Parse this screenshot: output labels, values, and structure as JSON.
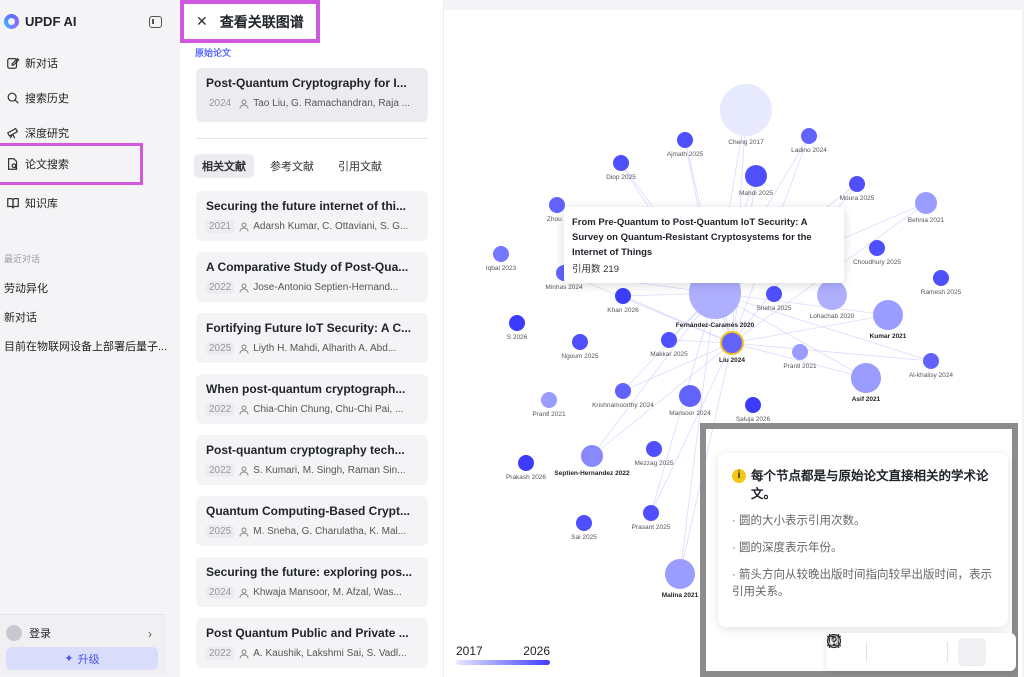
{
  "app": {
    "name": "UPDF AI"
  },
  "sidebar": {
    "nav": [
      {
        "label": "新对话",
        "icon": "edit-icon"
      },
      {
        "label": "搜索历史",
        "icon": "search-icon"
      },
      {
        "label": "深度研究",
        "icon": "telescope-icon"
      },
      {
        "label": "论文搜索",
        "icon": "paper-search-icon"
      },
      {
        "label": "知识库",
        "icon": "book-icon"
      }
    ],
    "recent_label": "最近对话",
    "recent": [
      "劳动异化",
      "新对话",
      "目前在物联网设备上部署后量子..."
    ],
    "login_label": "登录",
    "upgrade_label": "升级"
  },
  "panel": {
    "title": "查看关联图谱",
    "original_label": "原始论文",
    "original": {
      "title": "Post-Quantum Cryptography for I...",
      "year": "2024",
      "authors": "Tao Liu, G. Ramachandran, Raja ..."
    },
    "tabs": [
      "相关文献",
      "参考文献",
      "引用文献"
    ],
    "papers": [
      {
        "title": "Securing the future internet of thi...",
        "year": "2021",
        "authors": "Adarsh Kumar, C. Ottaviani, S. G..."
      },
      {
        "title": "A Comparative Study of Post-Qua...",
        "year": "2022",
        "authors": "Jose-Antonio Septien-Hernand..."
      },
      {
        "title": "Fortifying Future IoT Security: A C...",
        "year": "2025",
        "authors": "Liyth H. Mahdi, Alharith A. Abd..."
      },
      {
        "title": "When post-quantum cryptograph...",
        "year": "2022",
        "authors": "Chia-Chin Chung, Chu-Chi Pai, ..."
      },
      {
        "title": "Post-quantum cryptography tech...",
        "year": "2022",
        "authors": "S. Kumari, M. Singh, Raman Sin..."
      },
      {
        "title": "Quantum Computing-Based Crypt...",
        "year": "2025",
        "authors": "M. Sneha, G. Charulatha, K. Mal..."
      },
      {
        "title": "Securing the future: exploring pos...",
        "year": "2024",
        "authors": "Khwaja Mansoor, M. Afzal, Was..."
      },
      {
        "title": "Post Quantum Public and Private ...",
        "year": "2022",
        "authors": "A. Kaushik, Lakshmi Sai, S. Vadl..."
      }
    ]
  },
  "graph": {
    "nodes": [
      {
        "label": "Cheng 2017",
        "year": 2017,
        "size": "xl"
      },
      {
        "label": "Ajmath 2025",
        "year": 2025,
        "size": "s"
      },
      {
        "label": "Ladino 2024",
        "year": 2024,
        "size": "s"
      },
      {
        "label": "Diop 2025",
        "year": 2025,
        "size": "s"
      },
      {
        "label": "Mahdi 2025",
        "year": 2025,
        "size": "m"
      },
      {
        "label": "Moura 2025",
        "year": 2025,
        "size": "s"
      },
      {
        "label": "Zhou 2",
        "year": 2024,
        "size": "s"
      },
      {
        "label": "Behnia 2021",
        "year": 2021,
        "size": "m"
      },
      {
        "label": "Iqbal 2023",
        "year": 2023,
        "size": "s"
      },
      {
        "label": "Choudhury 2025",
        "year": 2025,
        "size": "s"
      },
      {
        "label": "Minhas 2024",
        "year": 2024,
        "size": "s"
      },
      {
        "label": "Ramesh 2025",
        "year": 2025,
        "size": "s"
      },
      {
        "label": "Sneha 2025",
        "year": 2025,
        "size": "s"
      },
      {
        "label": "Khan 2026",
        "year": 2026,
        "size": "s"
      },
      {
        "label": "Fernández-Caramés 2020",
        "year": 2020,
        "size": "xl",
        "bold": true
      },
      {
        "label": "Lohachab 2020",
        "year": 2020,
        "size": "l"
      },
      {
        "label": "Kumar 2021",
        "year": 2021,
        "size": "l",
        "bold": true
      },
      {
        "label": "S 2026",
        "year": 2026,
        "size": "s"
      },
      {
        "label": "Ngoum 2025",
        "year": 2025,
        "size": "s"
      },
      {
        "label": "Makkar 2025",
        "year": 2025,
        "size": "s"
      },
      {
        "label": "Liu 2024",
        "year": 2024,
        "size": "m",
        "bold": true
      },
      {
        "label": "Prantl 2021",
        "year": 2021,
        "size": "s"
      },
      {
        "label": "Al-khalisy 2024",
        "year": 2024,
        "size": "s"
      },
      {
        "label": "Asif 2021",
        "year": 2021,
        "size": "l",
        "bold": true
      },
      {
        "label": "Prantl 2021",
        "year": 2021,
        "size": "s"
      },
      {
        "label": "Krishnamoorthy 2024",
        "year": 2024,
        "size": "s"
      },
      {
        "label": "Mansoor 2024",
        "year": 2024,
        "size": "m"
      },
      {
        "label": "Saluja 2026",
        "year": 2026,
        "size": "s"
      },
      {
        "label": "Septien-Hernandez 2022",
        "year": 2022,
        "size": "m",
        "bold": true
      },
      {
        "label": "Mezzag 2025",
        "year": 2025,
        "size": "s"
      },
      {
        "label": "Prakash 2026",
        "year": 2026,
        "size": "s"
      },
      {
        "label": "Prasant 2025",
        "year": 2025,
        "size": "s"
      },
      {
        "label": "Sai 2025",
        "year": 2025,
        "size": "s"
      },
      {
        "label": "Malina 2021",
        "year": 2021,
        "size": "l",
        "bold": true
      }
    ],
    "tooltip": {
      "title": "From Pre-Quantum to Post-Quantum IoT Security: A Survey on Quantum-Resistant Cryptosystems for the Internet of Things",
      "citations": "引用数 219"
    },
    "legend": {
      "title": "每个节点都是与原始论文直接相关的学术论文。",
      "items": [
        "· 圆的大小表示引用次数。",
        "· 圆的深度表示年份。",
        "· 箭头方向从较晚出版时间指向较早出版时间，表示引用关系。"
      ]
    },
    "toolbar": [
      "fit-screen-icon",
      "zoom-in-icon",
      "zoom-out-icon",
      "help-icon"
    ],
    "scale": {
      "start": "2017",
      "end": "2026"
    }
  }
}
